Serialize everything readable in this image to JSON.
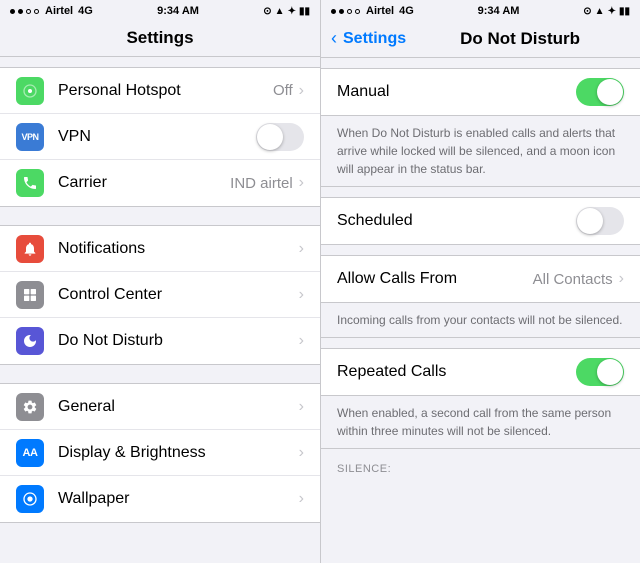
{
  "left": {
    "statusBar": {
      "carrier": "Airtel",
      "network": "4G",
      "time": "9:34 AM"
    },
    "navTitle": "Settings",
    "groups": [
      {
        "items": [
          {
            "id": "hotspot",
            "iconClass": "icon-hotspot",
            "iconText": "⊕",
            "label": "Personal Hotspot",
            "value": "Off",
            "hasChevron": true,
            "hasToggle": false
          },
          {
            "id": "vpn",
            "iconClass": "icon-vpn",
            "iconText": "VPN",
            "label": "VPN",
            "value": "",
            "hasChevron": false,
            "hasToggle": true,
            "toggleOn": false
          },
          {
            "id": "carrier",
            "iconClass": "icon-carrier",
            "iconText": "📞",
            "label": "Carrier",
            "value": "IND airtel",
            "hasChevron": true,
            "hasToggle": false
          }
        ]
      },
      {
        "items": [
          {
            "id": "notifications",
            "iconClass": "icon-notifications",
            "iconText": "🔔",
            "label": "Notifications",
            "value": "",
            "hasChevron": true,
            "hasToggle": false
          },
          {
            "id": "control-center",
            "iconClass": "icon-control-center",
            "iconText": "⊞",
            "label": "Control Center",
            "value": "",
            "hasChevron": true,
            "hasToggle": false
          },
          {
            "id": "dnd",
            "iconClass": "icon-dnd",
            "iconText": "🌙",
            "label": "Do Not Disturb",
            "value": "",
            "hasChevron": true,
            "hasToggle": false
          }
        ]
      },
      {
        "items": [
          {
            "id": "general",
            "iconClass": "icon-general",
            "iconText": "⚙",
            "label": "General",
            "value": "",
            "hasChevron": true,
            "hasToggle": false
          },
          {
            "id": "display",
            "iconClass": "icon-display",
            "iconText": "AA",
            "label": "Display & Brightness",
            "value": "",
            "hasChevron": true,
            "hasToggle": false
          },
          {
            "id": "wallpaper",
            "iconClass": "icon-wallpaper",
            "iconText": "✿",
            "label": "Wallpaper",
            "value": "",
            "hasChevron": true,
            "hasToggle": false
          }
        ]
      }
    ]
  },
  "right": {
    "statusBar": {
      "carrier": "Airtel",
      "network": "4G",
      "time": "9:34 AM"
    },
    "navBack": "Settings",
    "navTitle": "Do Not Disturb",
    "sections": [
      {
        "rows": [
          {
            "id": "manual",
            "label": "Manual",
            "toggleOn": true
          }
        ],
        "description": "When Do Not Disturb is enabled calls and alerts that arrive while locked will be silenced, and a moon icon will appear in the status bar."
      },
      {
        "rows": [
          {
            "id": "scheduled",
            "label": "Scheduled",
            "toggleOn": false
          }
        ],
        "description": ""
      },
      {
        "rows": [
          {
            "id": "allow-calls",
            "label": "Allow Calls From",
            "value": "All Contacts",
            "hasChevron": true
          }
        ],
        "description": "Incoming calls from your contacts will not be silenced."
      },
      {
        "rows": [
          {
            "id": "repeated-calls",
            "label": "Repeated Calls",
            "toggleOn": true
          }
        ],
        "description": "When enabled, a second call from the same person within three minutes will not be silenced."
      }
    ],
    "silenceLabel": "SILENCE:"
  }
}
